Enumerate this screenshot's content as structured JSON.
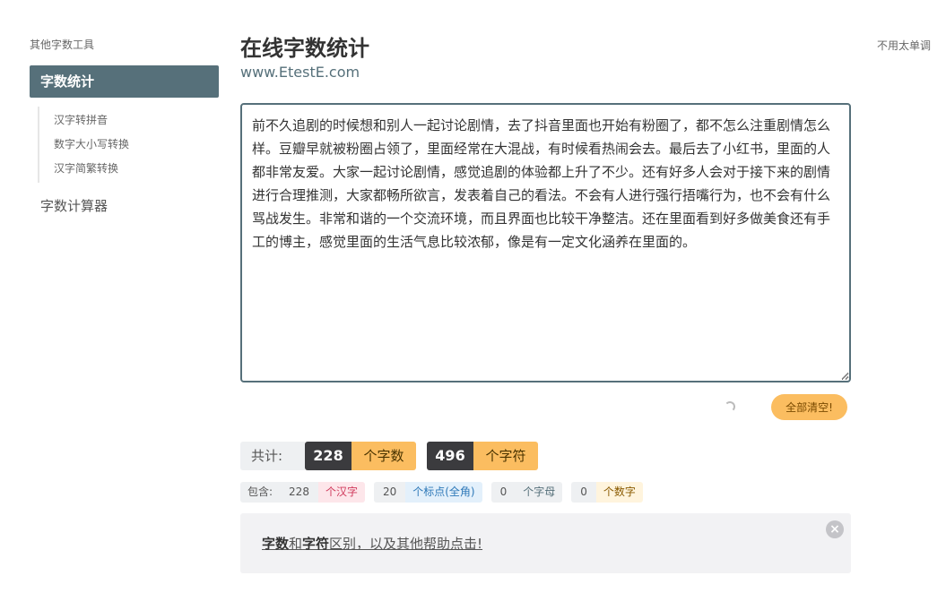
{
  "sidebar": {
    "heading": "其他字数工具",
    "active_item": "字数统计",
    "sub_items": [
      {
        "label": "汉字转拼音"
      },
      {
        "label": "数字大小写转换"
      },
      {
        "label": "汉字简繁转换"
      }
    ],
    "bottom_item": "字数计算器"
  },
  "top_right_link": "不用太单调",
  "header": {
    "title": "在线字数统计",
    "subtitle": "www.EtestE.com"
  },
  "editor": {
    "text": "前不久追剧的时候想和别人一起讨论剧情，去了抖音里面也开始有粉圈了，都不怎么注重剧情怎么样。豆瓣早就被粉圈占领了，里面经常在大混战，有时候看热闹会去。最后去了小红书，里面的人都非常友爱。大家一起讨论剧情，感觉追剧的体验都上升了不少。还有好多人会对于接下来的剧情进行合理推测，大家都畅所欲言，发表着自己的看法。不会有人进行强行捂嘴行为，也不会有什么骂战发生。非常和谐的一个交流环境，而且界面也比较干净整洁。还在里面看到好多做美食还有手工的博主，感觉里面的生活气息比较浓郁，像是有一定文化涵养在里面的。"
  },
  "clear_button": "全部清空!",
  "totals": {
    "label": "共计:",
    "char_count": "228",
    "char_unit": "个字数",
    "symbol_count": "496",
    "symbol_unit": "个字符"
  },
  "breakdown": {
    "label": "包含:",
    "hanzi_count": "228",
    "hanzi_unit": "个汉字",
    "punct_count": "20",
    "punct_unit": "个标点(全角)",
    "letter_count": "0",
    "letter_unit": "个字母",
    "digit_count": "0",
    "digit_unit": "个数字"
  },
  "help": {
    "part1": "字数",
    "part2": "和",
    "part3": "字符",
    "part4": "区别，以及其他帮助点击!",
    "close_symbol": "×"
  },
  "colors": {
    "accent": "#56707a",
    "orange": "#fbbd60",
    "dark": "#3b3b3e"
  }
}
